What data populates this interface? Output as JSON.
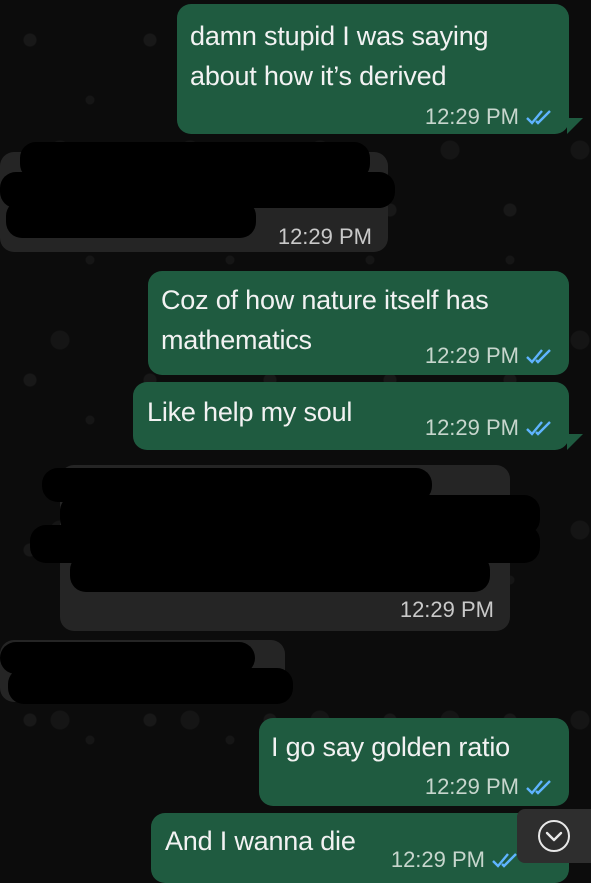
{
  "messages": [
    {
      "id": "m1",
      "direction": "outgoing",
      "lines": [
        "damn stupid I was saying",
        "about how it’s derived"
      ],
      "time": "12:29 PM",
      "read": true
    },
    {
      "id": "m2",
      "direction": "incoming",
      "lines": [],
      "time": "12:29 PM",
      "redacted": true
    },
    {
      "id": "m3",
      "direction": "outgoing",
      "lines": [
        "Coz of how nature itself has",
        "mathematics"
      ],
      "time": "12:29 PM",
      "read": true
    },
    {
      "id": "m4",
      "direction": "outgoing",
      "lines": [
        "Like help my soul"
      ],
      "time": "12:29 PM",
      "read": true
    },
    {
      "id": "m5",
      "direction": "incoming",
      "lines": [],
      "time": "12:29 PM",
      "redacted": true
    },
    {
      "id": "m6",
      "direction": "incoming",
      "lines": [],
      "time": "",
      "redacted": true
    },
    {
      "id": "m7",
      "direction": "outgoing",
      "lines": [
        "I go say golden ratio"
      ],
      "time": "12:29 PM",
      "read": true
    },
    {
      "id": "m8",
      "direction": "outgoing",
      "lines": [
        "And I wanna die"
      ],
      "time": "12:29 PM",
      "read": true
    }
  ],
  "colors": {
    "outgoing_bubble": "#1f5b40",
    "incoming_bubble": "#252525",
    "read_tick": "#5fb4ff",
    "background": "#0c0c0c"
  },
  "icons": {
    "read_receipt": "double-check-icon",
    "scroll_down": "chevron-down-circle-icon"
  }
}
